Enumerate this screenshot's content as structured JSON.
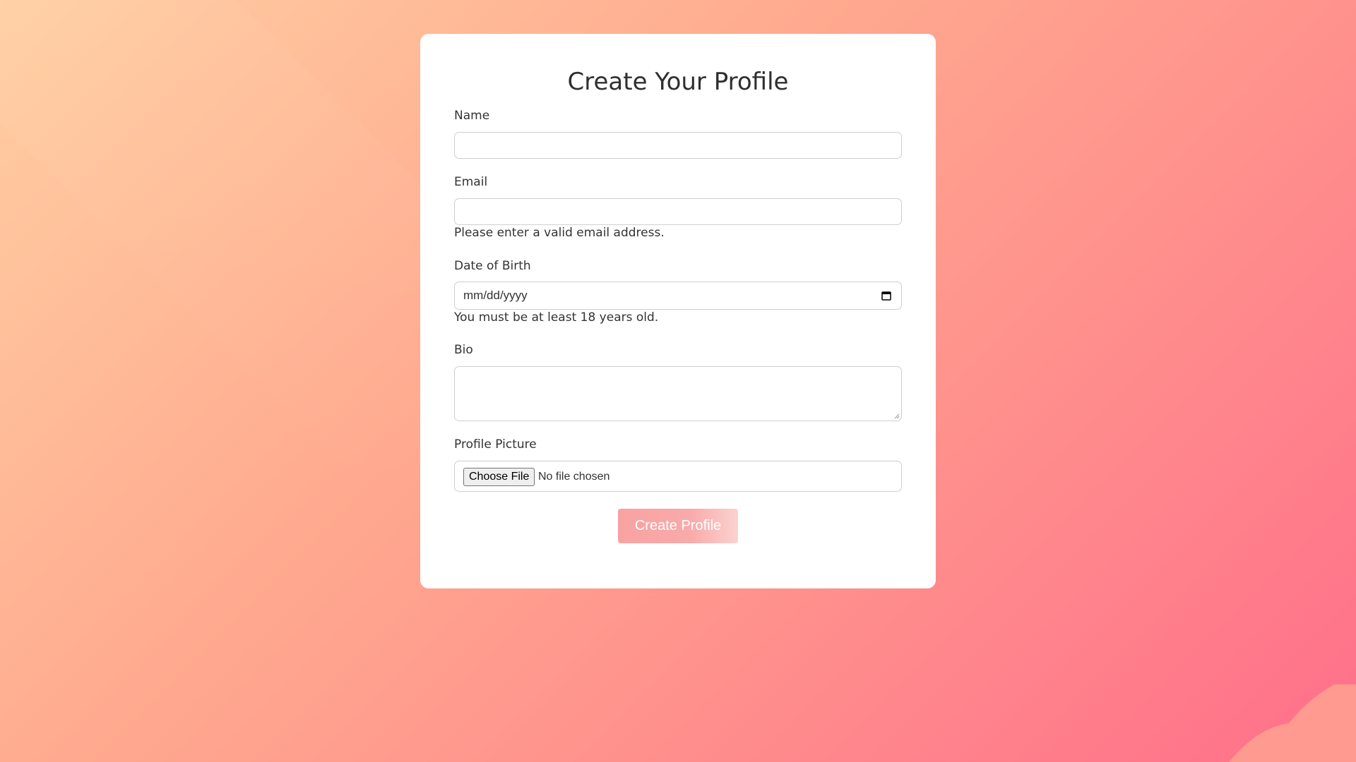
{
  "form": {
    "title": "Create Your Profile",
    "name_label": "Name",
    "name_value": "",
    "email_label": "Email",
    "email_value": "",
    "email_help": "Please enter a valid email address.",
    "dob_label": "Date of Birth",
    "dob_placeholder": "mm/dd/yyyy",
    "dob_help": "You must be at least 18 years old.",
    "bio_label": "Bio",
    "bio_value": "",
    "picture_label": "Profile Picture",
    "choose_file_label": "Choose File",
    "no_file_text": "No file chosen",
    "submit_label": "Create Profile"
  },
  "colors": {
    "background_start": "#ffcfa2",
    "background_end": "#ff6f8a",
    "card": "#ffffff",
    "button": "#f9a2a2"
  },
  "icons": {
    "date": "calendar-icon",
    "textarea": "resize-handle-icon"
  }
}
